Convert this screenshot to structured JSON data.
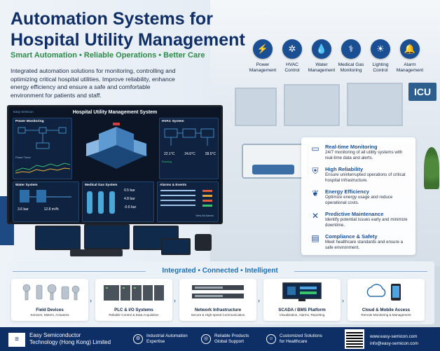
{
  "header": {
    "title_line1": "Automation Systems for",
    "title_line2": "Hospital Utility Management",
    "tagline": "Smart Automation  •  Reliable Operations  •  Better Care",
    "intro": "Integrated automation solutions for monitoring, controlling and optimizing critical hospital utilities. Improve reliability, enhance energy efficiency and ensure a safe and comfortable environment for patients and staff."
  },
  "categories": [
    {
      "icon": "power-icon",
      "glyph": "⚡",
      "label": "Power Management"
    },
    {
      "icon": "fan-icon",
      "glyph": "✲",
      "label": "HVAC Control"
    },
    {
      "icon": "water-drop-icon",
      "glyph": "💧",
      "label": "Water Management"
    },
    {
      "icon": "gas-cylinder-icon",
      "glyph": "⚕",
      "label": "Medical Gas Monitoring"
    },
    {
      "icon": "light-bulb-icon",
      "glyph": "☀",
      "label": "Lighting Control"
    },
    {
      "icon": "alarm-bell-icon",
      "glyph": "🔔",
      "label": "Alarm Management"
    }
  ],
  "room": {
    "icu_sign": "ICU"
  },
  "monitor": {
    "title": "Hospital Utility Management System",
    "logo": "Easy Semicon",
    "panels": {
      "power": {
        "title": "Power Monitoring",
        "sub": "Power Trend"
      },
      "hvac": {
        "title": "HVAC System",
        "v1": "22.1°C",
        "v2": "24.6°C",
        "v3": "28.5°C",
        "status": "Running"
      },
      "water": {
        "title": "Water System",
        "v1": "3.6 bar",
        "v2": "12.8 m³/h"
      },
      "gas": {
        "title": "Medical Gas System",
        "r1": "0.5 bar",
        "r2": "4.8 bar",
        "r3": "-0.6 bar"
      },
      "alarms": {
        "title": "Alarms & Events",
        "link": "View All Alarms"
      }
    }
  },
  "features": [
    {
      "icon": "realtime-monitor-icon",
      "glyph": "▭",
      "title": "Real-time Monitoring",
      "desc": "24/7 monitoring of all utility systems with real-time data and alerts."
    },
    {
      "icon": "shield-check-icon",
      "glyph": "⛨",
      "title": "High Reliability",
      "desc": "Ensure uninterrupted operations of critical hospital infrastructure."
    },
    {
      "icon": "leaf-icon",
      "glyph": "❦",
      "title": "Energy Efficiency",
      "desc": "Optimize energy usage and reduce operational costs."
    },
    {
      "icon": "wrench-icon",
      "glyph": "✕",
      "title": "Predictive Maintenance",
      "desc": "Identify potential issues early and minimize downtime."
    },
    {
      "icon": "clipboard-check-icon",
      "glyph": "▤",
      "title": "Compliance & Safety",
      "desc": "Meet healthcare standards and ensure a safe environment."
    }
  ],
  "band": {
    "title": "Integrated  •  Connected  •  Intelligent",
    "components": [
      {
        "name": "Field Devices",
        "sub": "Sensors, Meters, Actuators"
      },
      {
        "name": "PLC & I/O Systems",
        "sub": "Reliable Control & Data Acquisition"
      },
      {
        "name": "Network Infrastructure",
        "sub": "Secure & High-speed Communication"
      },
      {
        "name": "SCADA / BMS Platform",
        "sub": "Visualization, Alarms, Reporting"
      },
      {
        "name": "Cloud & Mobile Access",
        "sub": "Remote Monitoring & Management"
      }
    ]
  },
  "footer": {
    "company_line1": "Easy Semiconductor",
    "company_line2": "Technology (Hong Kong) Limited",
    "items": [
      {
        "icon": "gear-icon",
        "glyph": "⚙",
        "line1": "Industrial Automation",
        "line2": "Expertise"
      },
      {
        "icon": "globe-icon",
        "glyph": "◎",
        "line1": "Reliable Products",
        "line2": "Global Support"
      },
      {
        "icon": "user-group-icon",
        "glyph": "☺",
        "line1": "Customized Solutions",
        "line2": "for Healthcare"
      }
    ],
    "website": "www.easy-semicon.com",
    "email": "info@easy-semicon.com"
  }
}
